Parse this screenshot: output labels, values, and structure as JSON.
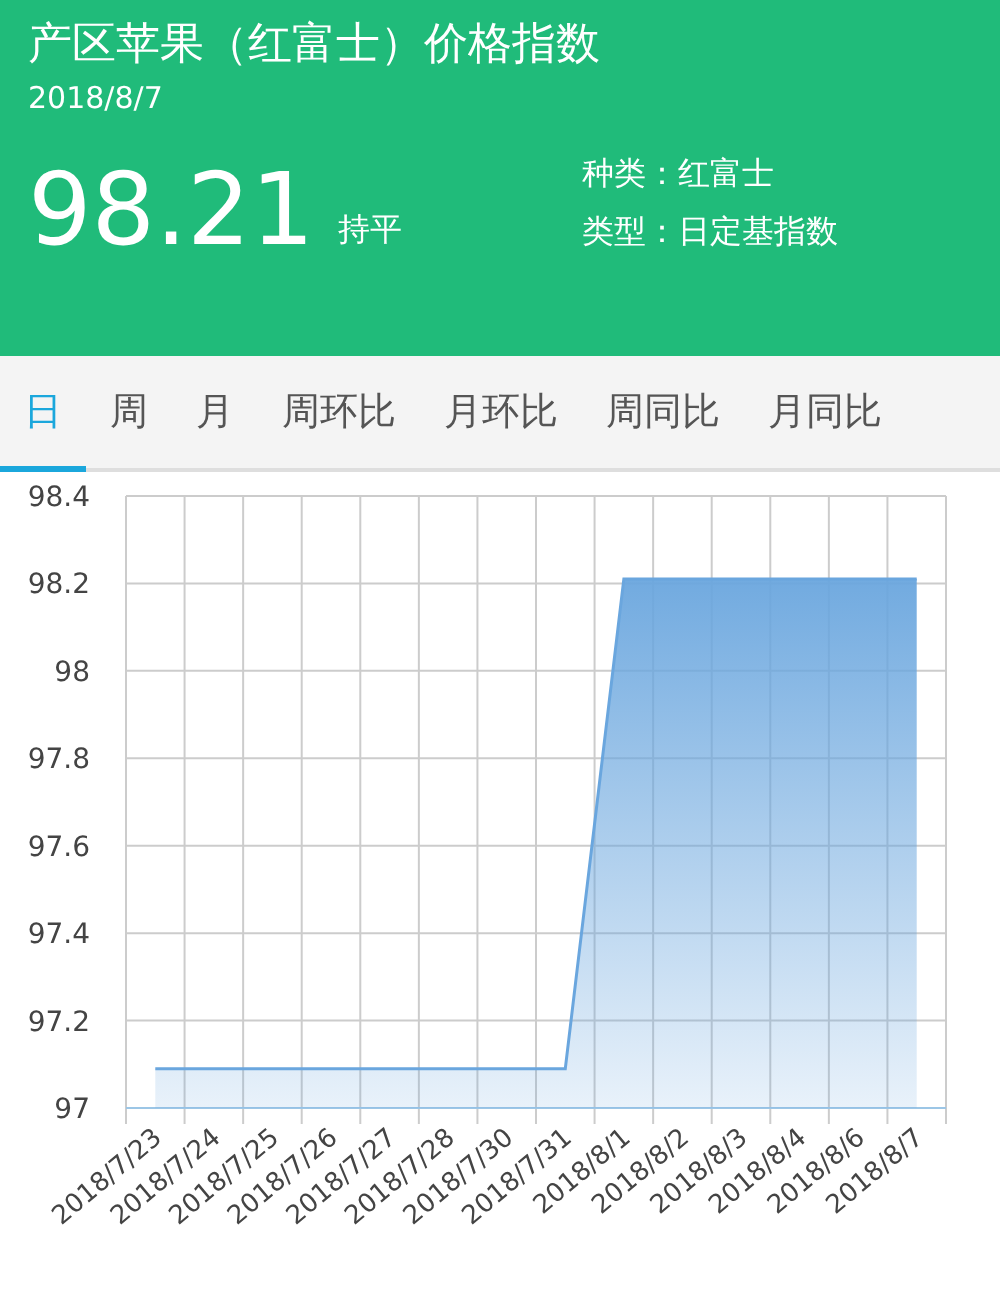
{
  "header": {
    "title": "产区苹果（红富士）价格指数",
    "date": "2018/8/7",
    "value": "98.21",
    "trend": "持平",
    "info": [
      "种类：红富士",
      "类型：日定基指数"
    ]
  },
  "tabs": [
    {
      "label": "日",
      "selected": true
    },
    {
      "label": "周",
      "selected": false
    },
    {
      "label": "月",
      "selected": false
    },
    {
      "label": "周环比",
      "selected": false
    },
    {
      "label": "月环比",
      "selected": false
    },
    {
      "label": "周同比",
      "selected": false
    },
    {
      "label": "月同比",
      "selected": false
    }
  ],
  "chart": {
    "chart_data": {
      "type": "area",
      "grid": true,
      "categories": [
        "2018/7/23",
        "2018/7/24",
        "2018/7/25",
        "2018/7/26",
        "2018/7/27",
        "2018/7/28",
        "2018/7/30",
        "2018/7/31",
        "2018/8/1",
        "2018/8/2",
        "2018/8/3",
        "2018/8/4",
        "2018/8/6",
        "2018/8/7"
      ],
      "series": [
        {
          "color": "#6aa6de",
          "values": [
            97.09,
            97.09,
            97.09,
            97.09,
            97.09,
            97.09,
            97.09,
            97.09,
            98.21,
            98.21,
            98.21,
            98.21,
            98.21,
            98.21
          ]
        }
      ],
      "ylim": [
        97,
        98.4
      ],
      "yticks": [
        {
          "value": 97,
          "label": "97"
        },
        {
          "value": 97.2,
          "label": "97.2"
        },
        {
          "value": 97.4,
          "label": "97.4"
        },
        {
          "value": 97.6,
          "label": "97.6"
        },
        {
          "value": 97.8,
          "label": "97.8"
        },
        {
          "value": 98,
          "label": "98"
        },
        {
          "value": 98.2,
          "label": "98.2"
        },
        {
          "value": 98.4,
          "label": "98.4"
        }
      ]
    }
  }
}
